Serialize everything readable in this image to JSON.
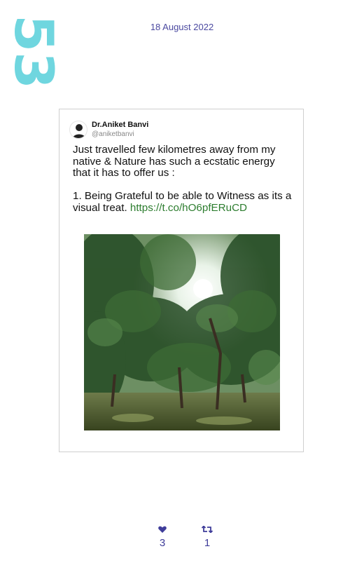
{
  "page": {
    "number": "53",
    "date": "18 August 2022"
  },
  "tweet": {
    "author": {
      "name": "Dr.Aniket Banvi",
      "handle": "@aniketbanvi"
    },
    "text": "Just travelled few kilometres away from my native & Nature has such a ecstatic energy that it has to offer us :\n\n1. Being Grateful to be able to Witness as its a visual treat. ",
    "link": "https://t.co/hO6pfERuCD",
    "image": {
      "subject": "forest trees with sun through canopy"
    },
    "stats": {
      "likes": "3",
      "retweets": "1"
    }
  },
  "icons": {
    "likes": "heart-icon",
    "retweets": "retweet-icon"
  },
  "colors": {
    "page_number": "#6fd6df",
    "date": "#4b49a0",
    "link": "#2d7d2f",
    "stats": "#3f3d9a"
  }
}
